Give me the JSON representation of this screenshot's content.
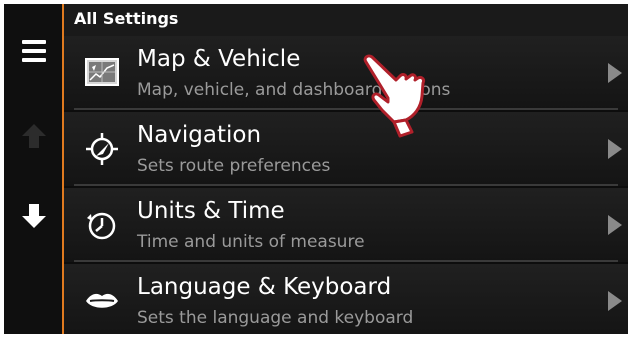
{
  "header": {
    "title": "All Settings"
  },
  "sidebar": {
    "menu_icon": "hamburger-menu-icon",
    "up_icon": "arrow-up-icon",
    "down_icon": "arrow-down-icon"
  },
  "items": [
    {
      "title": "Map & Vehicle",
      "subtitle": "Map, vehicle, and dashboard options",
      "icon": "map-icon"
    },
    {
      "title": "Navigation",
      "subtitle": "Sets route preferences",
      "icon": "navigation-icon"
    },
    {
      "title": "Units & Time",
      "subtitle": "Time and units of measure",
      "icon": "clock-icon"
    },
    {
      "title": "Language & Keyboard",
      "subtitle": "Sets the language and keyboard",
      "icon": "lips-icon"
    }
  ],
  "colors": {
    "accent": "#e07a1f",
    "text": "#ffffff",
    "subtext": "#9a9a9a",
    "background": "#0d0d0d",
    "pointer": "#b0202a"
  }
}
